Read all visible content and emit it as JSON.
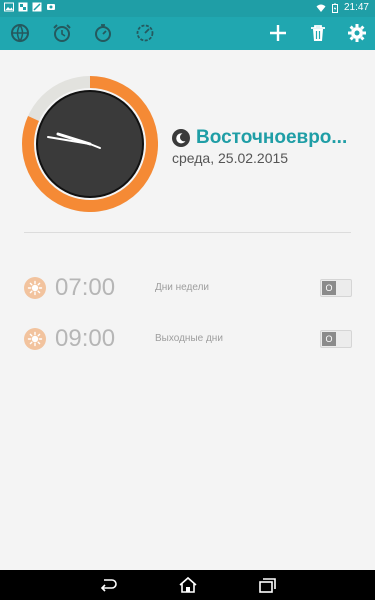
{
  "status_bar": {
    "time": "21:47",
    "left_icons": [
      "image-icon",
      "photo-icon",
      "recent-icon",
      "notification-icon"
    ],
    "right_icons": [
      "wifi-icon",
      "battery-charging-icon"
    ]
  },
  "toolbar": {
    "tabs": [
      {
        "icon": "globe-icon",
        "name": "world-clock"
      },
      {
        "icon": "alarm-clock-icon",
        "name": "alarm"
      },
      {
        "icon": "stopwatch-icon",
        "name": "stopwatch"
      },
      {
        "icon": "timer-icon",
        "name": "timer"
      }
    ],
    "actions": [
      {
        "icon": "plus-icon",
        "name": "add"
      },
      {
        "icon": "trash-icon",
        "name": "delete"
      },
      {
        "icon": "gear-icon",
        "name": "settings"
      }
    ]
  },
  "clock": {
    "timezone_name": "Восточноевро...",
    "date": "среда, 25.02.2015",
    "night_icon": "moon-icon"
  },
  "alarms": [
    {
      "time": "07:00",
      "label": "Дни недели",
      "toggle": "O",
      "icon": "sun-icon"
    },
    {
      "time": "09:00",
      "label": "Выходные дни",
      "toggle": "O",
      "icon": "sun-icon"
    }
  ],
  "nav_bar": {
    "buttons": [
      "back-icon",
      "home-icon",
      "recent-apps-icon"
    ]
  },
  "colors": {
    "accent": "#20a7b0",
    "ring": "#f58a35",
    "dial": "#3a3a3a",
    "sun_badge": "#f2c39e"
  }
}
